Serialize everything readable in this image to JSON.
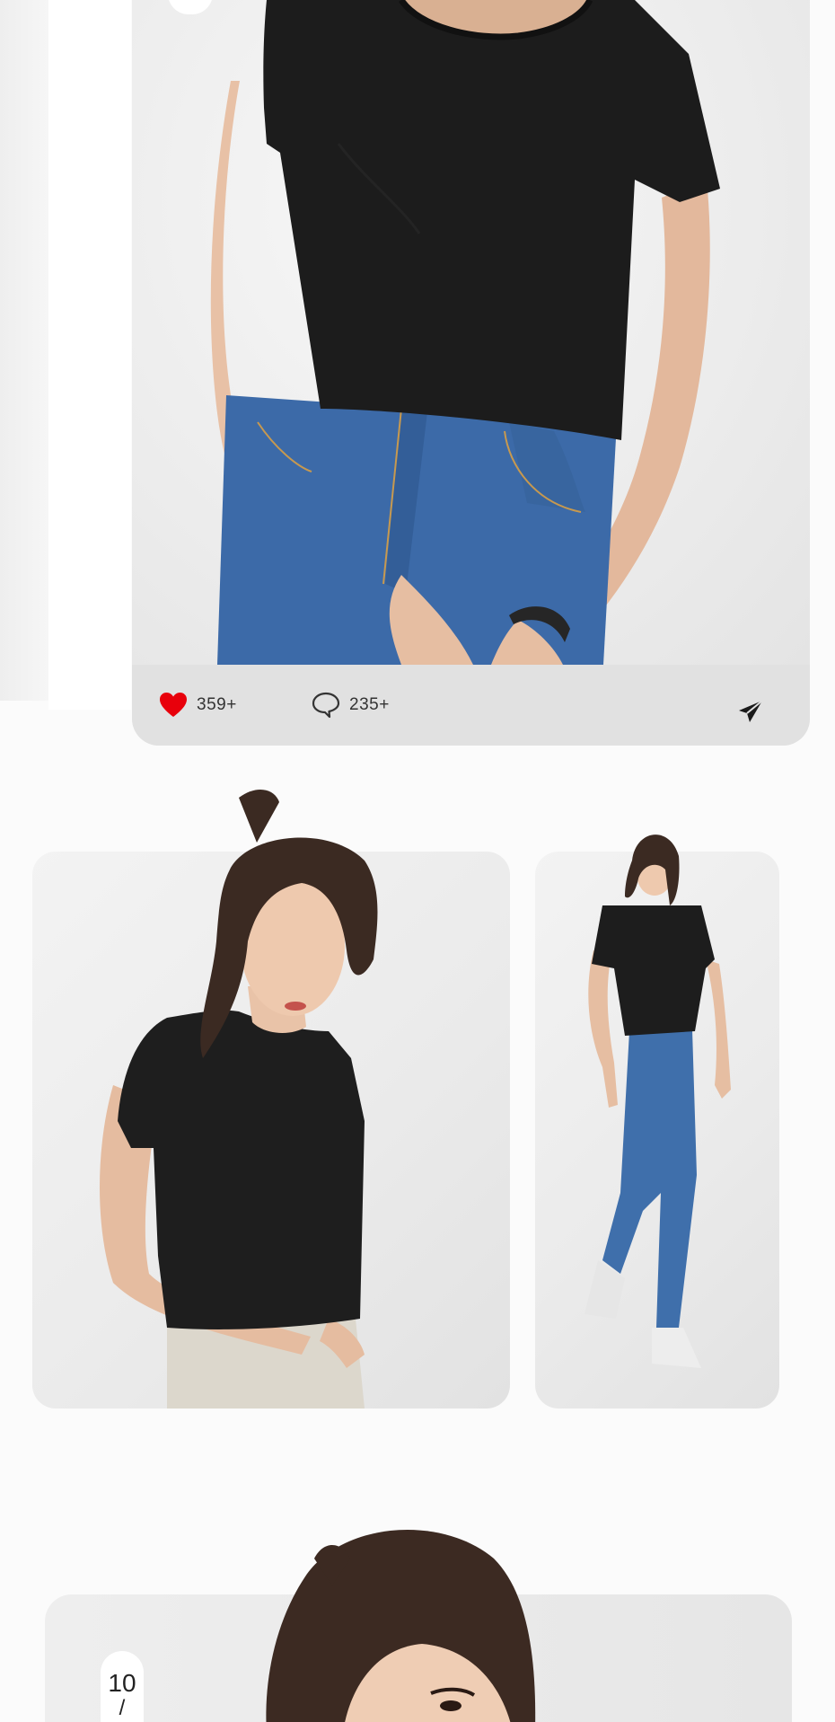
{
  "post": {
    "likes_count": "359+",
    "comments_count": "235+",
    "like_icon": "heart-icon",
    "comment_icon": "speech-bubble-icon",
    "share_icon": "paper-plane-icon",
    "like_color": "#e8000b"
  },
  "gallery": {
    "images": [
      {
        "name": "black-tee-closeup-photo"
      },
      {
        "name": "black-tee-portrait-photo"
      },
      {
        "name": "black-tee-fullbody-photo"
      },
      {
        "name": "black-tee-face-photo"
      }
    ]
  },
  "pager": {
    "current": "10",
    "separator": "/"
  }
}
